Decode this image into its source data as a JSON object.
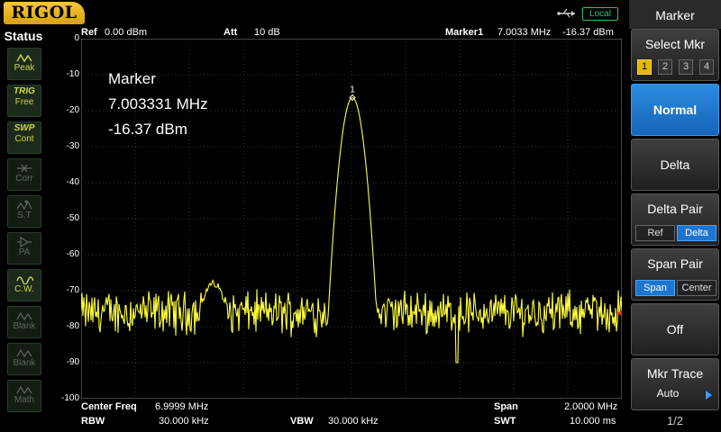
{
  "topbar": {
    "brand": "RIGOL",
    "local_badge": "Local"
  },
  "status": {
    "title": "Status",
    "items": [
      {
        "top": "",
        "label": "Peak",
        "icon": "peak-icon",
        "state": "on"
      },
      {
        "top": "TRIG",
        "label": "Free",
        "icon": "",
        "state": "on"
      },
      {
        "top": "SWP",
        "label": "Cont",
        "icon": "",
        "state": "on"
      },
      {
        "top": "",
        "label": "Corr",
        "icon": "corr-icon",
        "state": "off"
      },
      {
        "top": "",
        "label": "S.T",
        "icon": "st-icon",
        "state": "off"
      },
      {
        "top": "",
        "label": "PA",
        "icon": "pa-icon",
        "state": "off"
      },
      {
        "top": "",
        "label": "C.W.",
        "icon": "cw-icon",
        "state": "on"
      },
      {
        "top": "",
        "label": "Blank",
        "icon": "blank-icon",
        "state": "off"
      },
      {
        "top": "",
        "label": "Blank",
        "icon": "blank-icon",
        "state": "off"
      },
      {
        "top": "",
        "label": "Math",
        "icon": "math-icon",
        "state": "off"
      }
    ]
  },
  "header": {
    "ref_label": "Ref",
    "ref_value": "0.00 dBm",
    "att_label": "Att",
    "att_value": "10 dB",
    "marker_label": "Marker1",
    "marker_freq": "7.0033 MHz",
    "marker_level": "-16.37 dBm"
  },
  "marker_readout": {
    "title": "Marker",
    "freq": "7.003331 MHz",
    "level": "-16.37 dBm",
    "marker_tag": "1"
  },
  "footer": {
    "center_freq_label": "Center Freq",
    "center_freq_value": "6.9999 MHz",
    "span_label": "Span",
    "span_value": "2.0000 MHz",
    "rbw_label": "RBW",
    "rbw_value": "30.000 kHz",
    "vbw_label": "VBW",
    "vbw_value": "30.000 kHz",
    "swt_label": "SWT",
    "swt_value": "10.000 ms"
  },
  "menu": {
    "title": "Marker",
    "select_mkr_label": "Select Mkr",
    "marker_numbers": [
      "1",
      "2",
      "3",
      "4"
    ],
    "selected_marker": "1",
    "normal_label": "Normal",
    "delta_label": "Delta",
    "delta_pair_label": "Delta Pair",
    "delta_pair_options": [
      "Ref",
      "Delta"
    ],
    "delta_pair_selected": "Delta",
    "span_pair_label": "Span Pair",
    "span_pair_options": [
      "Span",
      "Center"
    ],
    "span_pair_selected": "Span",
    "off_label": "Off",
    "mkr_trace_label": "Mkr Trace",
    "mkr_trace_value": "Auto",
    "page_indicator": "1/2"
  },
  "chart_data": {
    "type": "line",
    "x_unit": "MHz",
    "y_unit": "dBm",
    "xlim": [
      5.9999,
      7.9999
    ],
    "ylim": [
      -100,
      0
    ],
    "yticks": [
      0,
      -10,
      -20,
      -30,
      -40,
      -50,
      -60,
      -70,
      -80,
      -90,
      -100
    ],
    "grid": true,
    "trace_color": "#ffff3c",
    "noise_floor_dbm": -76,
    "peak": {
      "x": 7.0033,
      "y": -16.37
    },
    "secondary_bump": {
      "x": 6.49,
      "y": -68
    },
    "deep_dip": {
      "x": 7.39,
      "y": -90
    }
  }
}
